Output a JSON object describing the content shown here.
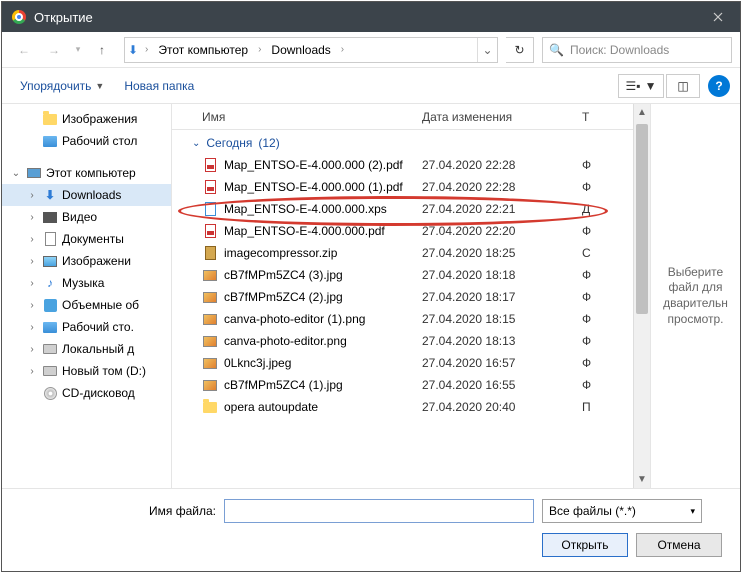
{
  "title": "Открытие",
  "breadcrumb": {
    "pc": "Этот компьютер",
    "folder": "Downloads"
  },
  "search_placeholder": "Поиск: Downloads",
  "toolbar": {
    "organize": "Упорядочить",
    "new_folder": "Новая папка"
  },
  "tree": {
    "pictures": "Изображения",
    "desktop": "Рабочий стол",
    "this_pc": "Этот компьютер",
    "downloads": "Downloads",
    "video": "Видео",
    "documents": "Документы",
    "images": "Изображени",
    "music": "Музыка",
    "objects3d": "Объемные об",
    "desktop2": "Рабочий сто.",
    "local_c": "Локальный д",
    "local_d": "Новый том (D:)",
    "cd": "CD-дисковод"
  },
  "columns": {
    "name": "Имя",
    "date": "Дата изменения",
    "type": "Т"
  },
  "group": {
    "label": "Сегодня",
    "count": "(12)"
  },
  "files": [
    {
      "ico": "pdf",
      "name": "Map_ENTSO-E-4.000.000 (2).pdf",
      "date": "27.04.2020 22:28",
      "t": "Ф"
    },
    {
      "ico": "pdf",
      "name": "Map_ENTSO-E-4.000.000 (1).pdf",
      "date": "27.04.2020 22:28",
      "t": "Ф"
    },
    {
      "ico": "xps",
      "name": "Map_ENTSO-E-4.000.000.xps",
      "date": "27.04.2020 22:21",
      "t": "Д"
    },
    {
      "ico": "pdf",
      "name": "Map_ENTSO-E-4.000.000.pdf",
      "date": "27.04.2020 22:20",
      "t": "Ф"
    },
    {
      "ico": "zip",
      "name": "imagecompressor.zip",
      "date": "27.04.2020 18:25",
      "t": "С"
    },
    {
      "ico": "jpg",
      "name": "cB7fMPm5ZC4 (3).jpg",
      "date": "27.04.2020 18:18",
      "t": "Ф"
    },
    {
      "ico": "jpg",
      "name": "cB7fMPm5ZC4 (2).jpg",
      "date": "27.04.2020 18:17",
      "t": "Ф"
    },
    {
      "ico": "jpg",
      "name": "canva-photo-editor (1).png",
      "date": "27.04.2020 18:15",
      "t": "Ф"
    },
    {
      "ico": "jpg",
      "name": "canva-photo-editor.png",
      "date": "27.04.2020 18:13",
      "t": "Ф"
    },
    {
      "ico": "jpg",
      "name": "0Lknc3j.jpeg",
      "date": "27.04.2020 16:57",
      "t": "Ф"
    },
    {
      "ico": "jpg",
      "name": "cB7fMPm5ZC4 (1).jpg",
      "date": "27.04.2020 16:55",
      "t": "Ф"
    },
    {
      "ico": "folder",
      "name": "opera autoupdate",
      "date": "27.04.2020 20:40",
      "t": "П"
    }
  ],
  "preview_hint": "Выберите файл для дварительн просмотр.",
  "footer": {
    "filename_label": "Имя файла:",
    "filter": "Все файлы (*.*)",
    "open": "Открыть",
    "cancel": "Отмена"
  }
}
